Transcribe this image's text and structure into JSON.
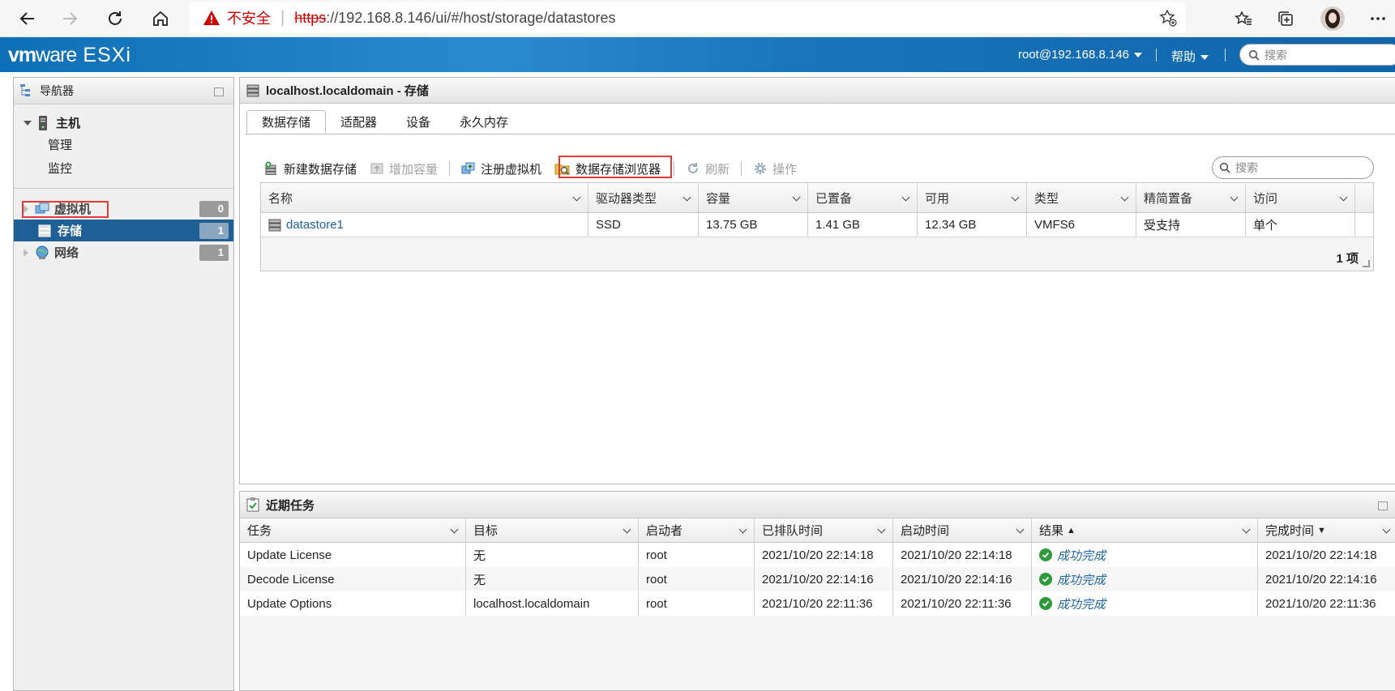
{
  "browser": {
    "insecure_label": "不安全",
    "url_protocol": "https",
    "url_rest": "://192.168.8.146/ui/#/host/storage/datastores"
  },
  "header": {
    "logo_vm": "vm",
    "logo_ware": "ware",
    "logo_product": "ESXi",
    "user": "root@192.168.8.146",
    "help": "帮助",
    "search_placeholder": "搜索"
  },
  "navigator": {
    "title": "导航器",
    "host": "主机",
    "host_children": [
      "管理",
      "监控"
    ],
    "items": [
      {
        "label": "虚拟机",
        "count": "0"
      },
      {
        "label": "存储",
        "count": "1"
      },
      {
        "label": "网络",
        "count": "1"
      }
    ]
  },
  "main": {
    "title": "localhost.localdomain - 存储",
    "tabs": [
      "数据存储",
      "适配器",
      "设备",
      "永久内存"
    ],
    "toolbar": {
      "new_datastore": "新建数据存储",
      "increase_capacity": "增加容量",
      "register_vm": "注册虚拟机",
      "datastore_browser": "数据存储浏览器",
      "refresh": "刷新",
      "actions": "操作"
    },
    "search_placeholder": "搜索",
    "table": {
      "columns": [
        "名称",
        "驱动器类型",
        "容量",
        "已置备",
        "可用",
        "类型",
        "精简置备",
        "访问"
      ],
      "rows": [
        [
          "datastore1",
          "SSD",
          "13.75 GB",
          "1.41 GB",
          "12.34 GB",
          "VMFS6",
          "受支持",
          "单个"
        ]
      ],
      "footer": "1 项"
    }
  },
  "tasks": {
    "title": "近期任务",
    "columns": [
      "任务",
      "目标",
      "启动者",
      "已排队时间",
      "启动时间",
      "结果",
      "完成时间"
    ],
    "sort_up": "▲",
    "sort_down": "▼",
    "rows": [
      [
        "Update License",
        "无",
        "root",
        "2021/10/20 22:14:18",
        "2021/10/20 22:14:18",
        "成功完成",
        "2021/10/20 22:14:18"
      ],
      [
        "Decode License",
        "无",
        "root",
        "2021/10/20 22:14:16",
        "2021/10/20 22:14:16",
        "成功完成",
        "2021/10/20 22:14:16"
      ],
      [
        "Update Options",
        "localhost.localdomain",
        "root",
        "2021/10/20 22:11:36",
        "2021/10/20 22:11:36",
        "成功完成",
        "2021/10/20 22:11:36"
      ]
    ]
  },
  "colors": {
    "header_blue": "#1873b8",
    "selected_nav": "#1e5f95",
    "highlight_red": "#e53935",
    "link_blue": "#1d63a8",
    "success_green": "#2e9b3a"
  }
}
